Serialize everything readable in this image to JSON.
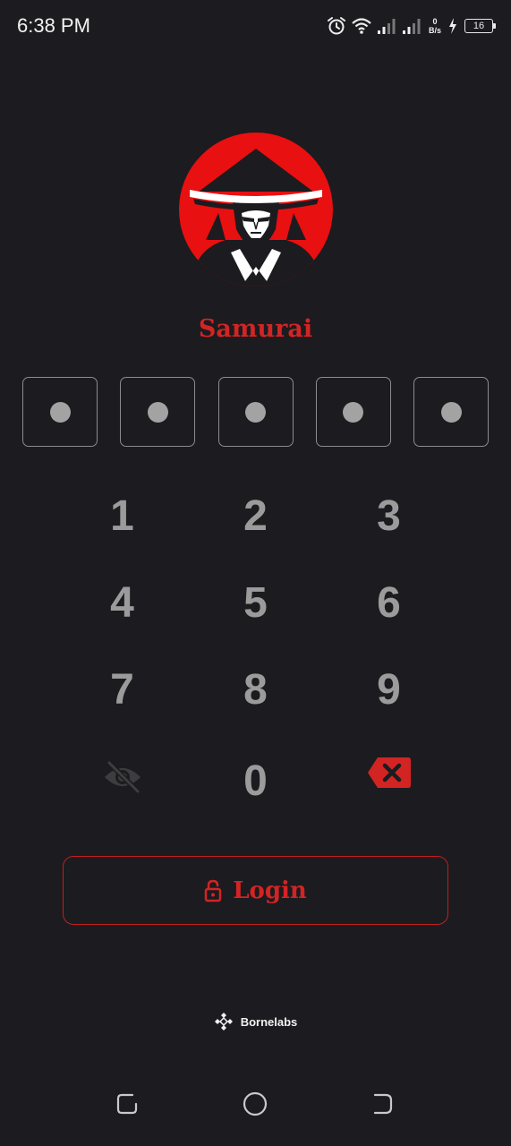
{
  "status_bar": {
    "time": "6:38 PM",
    "net_speed_value": "0",
    "net_speed_unit": "B/s",
    "battery_level": "16",
    "icons": [
      "alarm-icon",
      "wifi-icon",
      "signal-icon",
      "signal-icon",
      "charging-icon",
      "battery-icon"
    ]
  },
  "app": {
    "name": "Samurai",
    "logo_icon": "samurai-logo",
    "accent_color": "#d32424",
    "background_color": "#1c1b1f"
  },
  "pin": {
    "length": 5,
    "filled": 5
  },
  "keypad": {
    "keys": [
      "1",
      "2",
      "3",
      "4",
      "5",
      "6",
      "7",
      "8",
      "9"
    ],
    "zero": "0",
    "left_icon": "eye-off-icon",
    "right_icon": "backspace-icon"
  },
  "login": {
    "label": "Login",
    "icon": "lock-open-icon"
  },
  "footer": {
    "brand": "Bornelabs",
    "brand_icon": "bornelabs-logo-icon"
  },
  "nav_bar": {
    "items": [
      "recent-apps-icon",
      "home-icon",
      "back-icon"
    ]
  }
}
